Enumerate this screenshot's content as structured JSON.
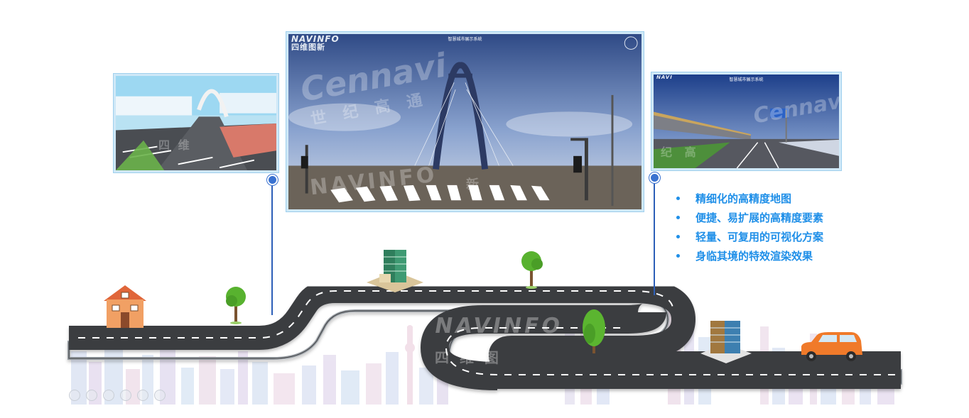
{
  "left_panel": {
    "icon": "bridge-aerial-screenshot"
  },
  "center_panel": {
    "brand_en": "NAVINFO",
    "brand_cn": "四维图新",
    "title": "智慧城市展示系统",
    "watermark_en": "Cennavi",
    "watermark_cn": "世 纪 高 通",
    "watermark2_en": "NAVINFO",
    "watermark2_cn": "新",
    "icon": "bridge-street-screenshot"
  },
  "right_panel": {
    "brand_en": "NAVI",
    "title": "智慧城市展示系统",
    "watermark_en": "Cennavi",
    "watermark_cn": "纪 高",
    "icon": "elevated-road-screenshot"
  },
  "features": [
    "精细化的高精度地图",
    "便捷、易扩展的高精度要素",
    "轻量、可复用的可视化方案",
    "身临其境的特效渲染效果"
  ],
  "road_watermark": {
    "en": "NAVINFO",
    "cn": "四 维 图"
  },
  "colors": {
    "feature_text": "#1f8fe8",
    "connector": "#2d5fb8",
    "road": "#3a3b3e",
    "lane_mark": "#ffffff",
    "panel_border": "#9fd0ee"
  },
  "icons": [
    "house-icon",
    "tree-icon",
    "office-building-icon",
    "car-icon",
    "city-skyline-icon"
  ]
}
